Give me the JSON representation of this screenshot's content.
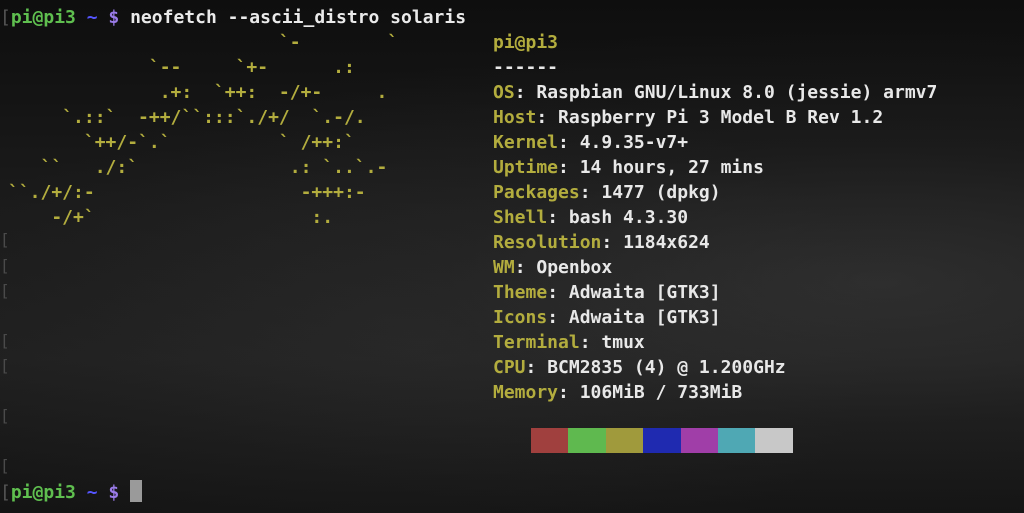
{
  "prompt": {
    "user_host": "pi@pi3",
    "tilde": "~",
    "dollar": "$",
    "command": "neofetch --ascii_distro solaris",
    "left_bracket": "["
  },
  "ascii_art": "                         `-        `\n             `--     `+-      .:\n              .+:  `++:  -/+-     .\n     `.::`  -++/``:::`./+/  `.-/.\n       `++/-`.`          ` /++:`\n   ``   ./:`              .: `..`.-\n``./+/:-                   -+++:-\n    -/+`                    :.",
  "info": {
    "title": "pi@pi3",
    "separator": "------",
    "rows": [
      {
        "key": "OS",
        "value": "Raspbian GNU/Linux 8.0 (jessie) armv7"
      },
      {
        "key": "Host",
        "value": "Raspberry Pi 3 Model B Rev 1.2"
      },
      {
        "key": "Kernel",
        "value": "4.9.35-v7+"
      },
      {
        "key": "Uptime",
        "value": "14 hours, 27 mins"
      },
      {
        "key": "Packages",
        "value": "1477 (dpkg)"
      },
      {
        "key": "Shell",
        "value": "bash 4.3.30"
      },
      {
        "key": "Resolution",
        "value": "1184x624"
      },
      {
        "key": "WM",
        "value": "Openbox"
      },
      {
        "key": "Theme",
        "value": "Adwaita [GTK3]"
      },
      {
        "key": "Icons",
        "value": "Adwaita [GTK3]"
      },
      {
        "key": "Terminal",
        "value": "tmux"
      },
      {
        "key": "CPU",
        "value": "BCM2835 (4) @ 1.200GHz"
      },
      {
        "key": "Memory",
        "value": "106MiB / 733MiB"
      }
    ]
  },
  "palette": [
    "#a0403e",
    "#5fb94f",
    "#a09a3c",
    "#1f2ab0",
    "#a03ea8",
    "#4fa8b4",
    "#c8c8c8"
  ],
  "cursor_color": "#9a9a9a"
}
